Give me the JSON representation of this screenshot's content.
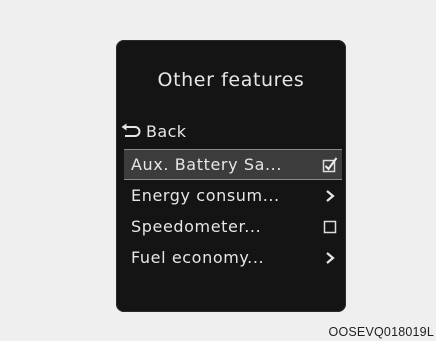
{
  "menu": {
    "title": "Other features",
    "back_label": "Back",
    "items": [
      {
        "label": "Aux. Battery Sa...",
        "control": "checkbox",
        "checked": true,
        "selected": true
      },
      {
        "label": "Energy consum...",
        "control": "arrow",
        "checked": false,
        "selected": false
      },
      {
        "label": "Speedometer...",
        "control": "checkbox",
        "checked": false,
        "selected": false
      },
      {
        "label": "Fuel economy...",
        "control": "arrow",
        "checked": false,
        "selected": false
      }
    ]
  },
  "figure_code": "OOSEVQ018019L",
  "colors": {
    "screen_background": "#141414",
    "text": "#e6e6e6",
    "selected_row": "#3c3c3c"
  },
  "icons": {
    "back": "return-arrow-icon",
    "checkbox_checked": "checkbox-checked-icon",
    "checkbox_empty": "checkbox-empty-icon",
    "arrow": "chevron-right-icon"
  }
}
